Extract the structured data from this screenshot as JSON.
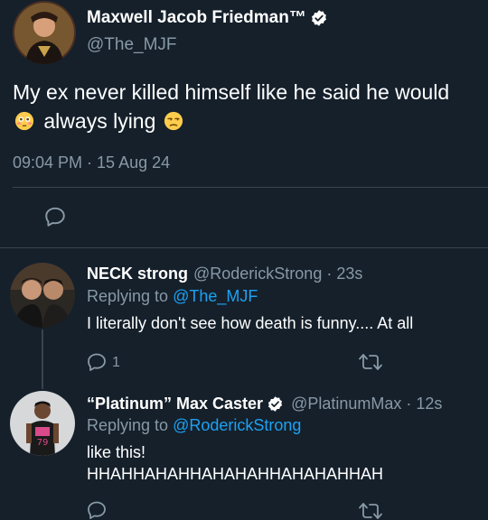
{
  "main_tweet": {
    "author_name": "Maxwell Jacob Friedman™",
    "handle": "@The_MJF",
    "text_part1": "My ex never killed himself like he said he would",
    "emoji1": "flushed-face",
    "text_part2": "always lying",
    "emoji2": "unamused-face",
    "timestamp": "09:04 PM · 15 Aug 24"
  },
  "replies": [
    {
      "author_name": "NECK strong",
      "handle": "@RoderickStrong",
      "age": "· 23s",
      "replying_label": "Replying to",
      "replying_to": "@The_MJF",
      "text": "I literally don't see how death is funny.... At all",
      "reply_count": "1"
    },
    {
      "author_name": "“Platinum” Max Caster",
      "handle": "@PlatinumMax",
      "age": "· 12s",
      "replying_label": "Replying to",
      "replying_to": "@RoderickStrong",
      "text_line1": "like this!",
      "text_line2": "HHAHHAHAHHAHAHAHHAHAHAHHAH"
    }
  ],
  "colors": {
    "background": "#15202b",
    "muted": "#8899a6",
    "link": "#1da1f2",
    "divider": "#38444d"
  }
}
